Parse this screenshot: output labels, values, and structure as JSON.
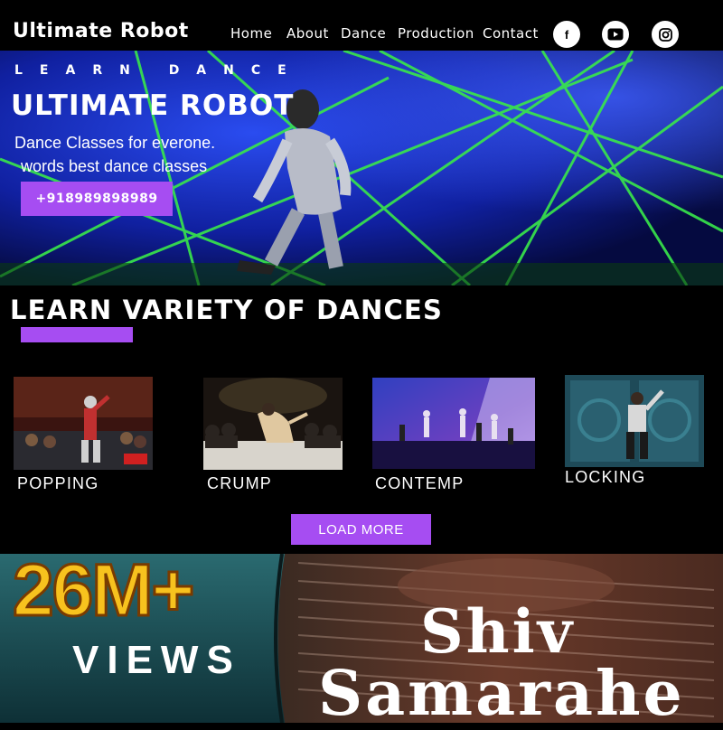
{
  "header": {
    "brand": "Ultimate Robot",
    "nav": [
      "Home",
      "About",
      "Dance",
      "Production",
      "Contact"
    ],
    "social": [
      {
        "icon": "facebook-icon",
        "glyph": "f"
      },
      {
        "icon": "youtube-icon"
      },
      {
        "icon": "instagram-icon"
      }
    ]
  },
  "hero": {
    "eyebrow": "LEARN DANCE",
    "title": "ULTIMATE ROBOT",
    "subtitle_line1": "Dance Classes for everone.",
    "subtitle_line2": "words best dance classes",
    "phone_label": "+918989898989"
  },
  "dances": {
    "title": "LEARN VARIETY OF DANCES",
    "items": [
      {
        "label": "POPPING"
      },
      {
        "label": "CRUMP"
      },
      {
        "label": "CONTEMP"
      },
      {
        "label": "LOCKING"
      }
    ],
    "load_more_label": "LOAD MORE"
  },
  "banner": {
    "views_count": "26M+",
    "views_label": "VIEWS",
    "title_line1": "Shiv",
    "title_line2": "Samarahe"
  },
  "colors": {
    "accent": "#a64df2",
    "counter": "#f7c21e",
    "laser": "#39e84a",
    "stage_blue": "#1530c8"
  }
}
